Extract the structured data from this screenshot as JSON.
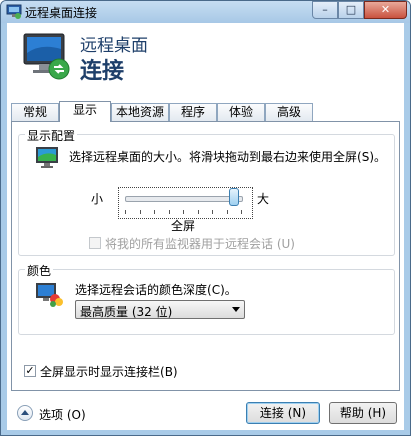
{
  "window": {
    "title": "远程桌面连接",
    "min_glyph": "–",
    "max_glyph": "□",
    "close_glyph": "✕"
  },
  "header": {
    "line1": "远程桌面",
    "line2": "连接"
  },
  "tabs": [
    {
      "label": "常规"
    },
    {
      "label": "显示"
    },
    {
      "label": "本地资源"
    },
    {
      "label": "程序"
    },
    {
      "label": "体验"
    },
    {
      "label": "高级"
    }
  ],
  "display_config": {
    "title": "显示配置",
    "description": "选择远程桌面的大小。将滑块拖动到最右边来使用全屏",
    "description_key": "(S)。",
    "small_label": "小",
    "large_label": "大",
    "slider_value_label": "全屏",
    "slider_fraction": 1.0,
    "multimon_label": "将我的所有监视器用于远程会话",
    "multimon_key": "(U)",
    "multimon_checked": false
  },
  "colors": {
    "title": "颜色",
    "description": "选择远程会话的颜色深度",
    "description_key": "(C)。",
    "selected": "最高质量 (32 位)"
  },
  "fullscreen_bar": {
    "label": "全屏显示时显示连接栏",
    "key": "(B)",
    "checked": true,
    "check_glyph": "✓"
  },
  "bottom": {
    "options_label": "选项",
    "options_key": "(O)",
    "connect_label": "连接",
    "connect_key": "(N)",
    "help_label": "帮助",
    "help_key": "(H)"
  }
}
